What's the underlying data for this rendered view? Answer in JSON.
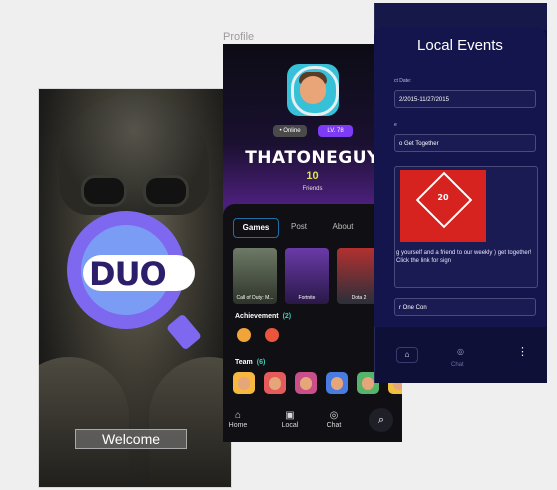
{
  "welcome": {
    "logo_text": "DUO",
    "button_label": "Welcome"
  },
  "profile": {
    "section_label": "Profile",
    "status": "• Online",
    "level": "LV. 78",
    "username": "THATONEGUY",
    "friends_count": "10",
    "friends_label": "Friends",
    "tabs": [
      {
        "label": "Games"
      },
      {
        "label": "Post"
      },
      {
        "label": "About"
      }
    ],
    "games": [
      {
        "title": "Call of Duty: M..."
      },
      {
        "title": "Fortnite"
      },
      {
        "title": "Dota 2"
      },
      {
        "title": "Gr"
      }
    ],
    "achievement_label": "Achievement",
    "achievement_count": "(2)",
    "team_label": "Team",
    "team_count": "(6)",
    "nav": {
      "home": "Home",
      "local": "Local",
      "chat": "Chat"
    },
    "icons": {
      "home": "home-icon",
      "local": "calendar-icon",
      "chat": "chat-icon",
      "search": "search-icon"
    }
  },
  "events": {
    "title": "Local Events",
    "date_label": "ct Date:",
    "date_value": "2/2015-11/27/2015",
    "name_label": "e",
    "name_value": "o Get Together",
    "die_number": "20",
    "description": "g yourself and a friend to our weekly ) get together! Click the link for sign",
    "con_value": "r One Con",
    "chat_label": "Chat",
    "more_glyph": "⋮"
  },
  "colors": {
    "accent_purple": "#7d3cf4",
    "teal": "#3dd0b6",
    "yellow": "#d7e64b",
    "event_red": "#d7231f",
    "events_bg": "#0f1037"
  }
}
